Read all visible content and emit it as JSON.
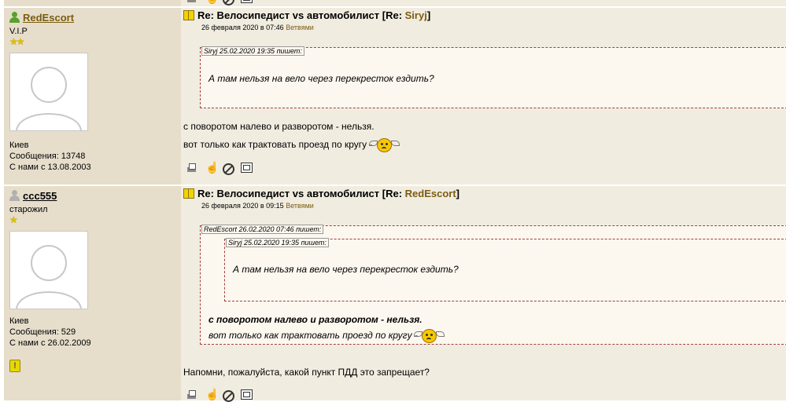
{
  "posts": [
    {
      "username": "RedEscort",
      "status_color": "#5aa02c",
      "rank": "V.I.P",
      "stars": "★★",
      "info": {
        "city": "Киев",
        "messages": "Сообщения: 13748",
        "since": "С нами с 13.08.2003"
      },
      "title_prefix": "Re: Велосипедист vs автомобилист [Re: ",
      "title_user": "Siryj",
      "title_suffix": "]",
      "date": "26 февраля 2020 в 07:46",
      "date_link": "Ветвями",
      "quote": {
        "label": "Siryj 25.02.2020 19:35 пишет:",
        "text": "А там нельзя на вело через перекресток ездить?"
      },
      "body": [
        "с поворотом налево и разворотом - нельзя.",
        "вот только как трактовать проезд по кругу - "
      ]
    },
    {
      "username": "ccc555",
      "status_color": "#b0b0b0",
      "rank": "старожил",
      "stars": "★",
      "info": {
        "city": "Киев",
        "messages": "Сообщения: 529",
        "since": "С нами с 26.02.2009"
      },
      "warn": "!",
      "title_prefix": "Re: Велосипедист vs автомобилист [Re: ",
      "title_user": "RedEscort",
      "title_suffix": "]",
      "date": "26 февраля 2020 в 09:15",
      "date_link": "Ветвями",
      "outer_quote": {
        "label": "RedEscort 26.02.2020 07:46 пишет:",
        "inner_label": "Siryj 25.02.2020 19:35 пишет:",
        "inner_text": "А там нельзя на вело через перекресток ездить?",
        "line1": "с поворотом налево и разворотом - нельзя.",
        "line2": "вот только как трактовать проезд по кругу - "
      },
      "body": "Напомни, пожалуйста, какой пункт ПДД это запрещает?"
    }
  ],
  "top_strip_icons": [
    "print-icon",
    "hand-icon",
    "ban-icon",
    "window-icon"
  ]
}
